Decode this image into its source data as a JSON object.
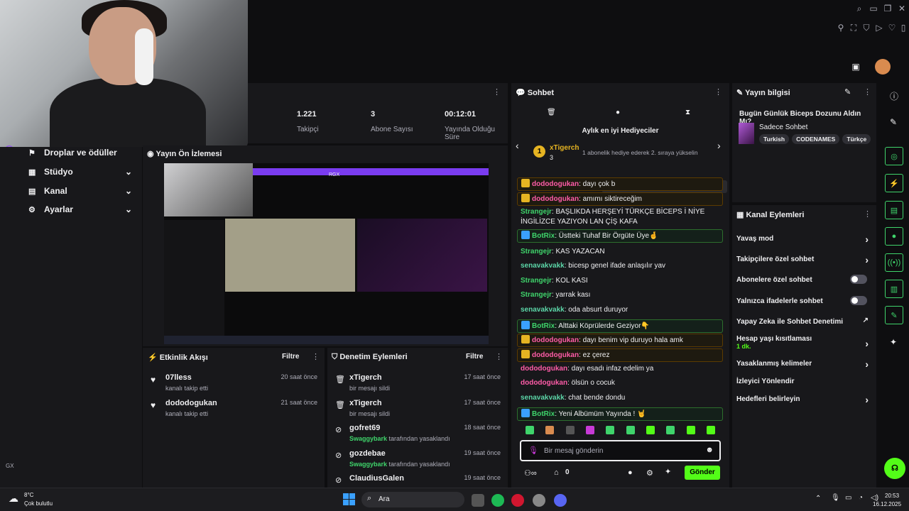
{
  "stats": {
    "followers_value": "1.221",
    "followers_label": "Takipçi",
    "subs_value": "3",
    "subs_label": "Abone Sayısı",
    "uptime_value": "00:12:01",
    "uptime_label": "Yayında Olduğu Süre"
  },
  "nav": {
    "items": [
      {
        "label": "Droplar ve ödüller"
      },
      {
        "label": "Stüdyo"
      },
      {
        "label": "Kanal"
      },
      {
        "label": "Ayarlar"
      }
    ],
    "footer": "GX"
  },
  "preview": {
    "title": "Yayın Ön İzlemesi",
    "overlay_label": "RGX"
  },
  "activity": {
    "title": "Etkinlik Akışı",
    "filter": "Filtre",
    "items": [
      {
        "name": "07lless",
        "sub": "kanalı takip etti",
        "time": "20 saat önce"
      },
      {
        "name": "dododogukan",
        "sub": "kanalı takip etti",
        "time": "21 saat önce"
      }
    ]
  },
  "moderation": {
    "title": "Denetim Eylemleri",
    "filter": "Filtre",
    "items": [
      {
        "name": "xTigerch",
        "sub": "bir mesajı sildi",
        "time": "17 saat önce"
      },
      {
        "name": "xTigerch",
        "sub": "bir mesajı sildi",
        "time": "17 saat önce"
      },
      {
        "name": "gofret69",
        "sub_user": "Swaggybark",
        "sub": "tarafından yasaklandı",
        "time": "18 saat önce"
      },
      {
        "name": "gozdebae",
        "sub_user": "Swaggybark",
        "sub": "tarafından yasaklandı",
        "time": "19 saat önce"
      },
      {
        "name": "ClaudiusGalen",
        "time": "19 saat önce"
      }
    ]
  },
  "chat": {
    "title": "Sohbet",
    "gifters_title": "Aylık en iyi Hediyeciler",
    "gifter_name": "xTigerch",
    "gifter_rank": "1",
    "gifter_count": "3",
    "gifter_promo": "1 abonelik hediye ederek 2. sıraya yükselin",
    "messages": [
      {
        "user": "dododogukan",
        "text": "dayı çok b",
        "style": "hl",
        "ucls": "u-pink"
      },
      {
        "user": "dododogukan",
        "text": "amımı siktireceğim",
        "style": "hl",
        "ucls": "u-pink"
      },
      {
        "user": "Strangejr",
        "text": "BAŞLIKDA HERŞEYİ TÜRKÇE BİCEPS İ NİYE İNGİLİZCE YAZIYON LAN ÇİŞ KAFA",
        "style": "",
        "ucls": "u-green"
      },
      {
        "user": "BotRix",
        "text": "Üstteki Tuhaf Bir Örgüte Üye🤞",
        "style": "hlg",
        "ucls": "u-green"
      },
      {
        "user": "Strangejr",
        "text": "KAS YAZACAN",
        "style": "",
        "ucls": "u-green"
      },
      {
        "user": "senavakvakk",
        "text": "bicesp genel ifade anlaşılır yav",
        "style": "",
        "ucls": "u-teal"
      },
      {
        "user": "Strangejr",
        "text": "KOL KASI",
        "style": "",
        "ucls": "u-green"
      },
      {
        "user": "Strangejr",
        "text": "yarrak kası",
        "style": "",
        "ucls": "u-green"
      },
      {
        "user": "senavakvakk",
        "text": "oda absurt duruyor",
        "style": "",
        "ucls": "u-teal"
      },
      {
        "user": "BotRix",
        "text": "Alttaki Köprülerde Geziyor👇",
        "style": "hlg",
        "ucls": "u-green"
      },
      {
        "user": "dododogukan",
        "text": "dayı benim vip duruyo hala amk",
        "style": "hl",
        "ucls": "u-pink"
      },
      {
        "user": "dododogukan",
        "text": "ez çerez",
        "style": "hl",
        "ucls": "u-pink"
      },
      {
        "user": "dododogukan",
        "text": "dayı esadı infaz edelim ya",
        "style": "",
        "ucls": "u-pink"
      },
      {
        "user": "dododogukan",
        "text": "ölsün o cocuk",
        "style": "",
        "ucls": "u-pink"
      },
      {
        "user": "senavakvakk",
        "text": "chat bende dondu",
        "style": "",
        "ucls": "u-teal"
      },
      {
        "user": "BotRix",
        "text": "Yeni Albümüm Yayında ! 🤘",
        "style": "hlg",
        "ucls": "u-green"
      }
    ],
    "input_placeholder": "Bir mesaj gönderin",
    "send_label": "Gönder",
    "points": "0"
  },
  "info": {
    "title": "Yayın bilgisi",
    "stream_title": "Bugün Günlük Biceps Dozunu Aldın Mı?",
    "category": "Sadece Sohbet",
    "tags": [
      "Turkish",
      "CODENAMES",
      "Türkçe"
    ]
  },
  "actions": {
    "title": "Kanal Eylemleri",
    "items": [
      {
        "label": "Yavaş mod",
        "kind": "chev"
      },
      {
        "label": "Takipçilere özel sohbet",
        "kind": "chev"
      },
      {
        "label": "Abonelere özel sohbet",
        "kind": "toggle"
      },
      {
        "label": "Yalnızca ifadelerle sohbet",
        "kind": "toggle"
      },
      {
        "label": "Yapay Zeka ile Sohbet Denetimi",
        "kind": "ext"
      },
      {
        "label": "Hesap yaşı kısıtlaması",
        "sub": "1 dk.",
        "kind": "chev"
      },
      {
        "label": "Yasaklanmış kelimeler",
        "kind": "chev"
      },
      {
        "label": "İzleyici Yönlendir",
        "kind": "none"
      },
      {
        "label": "Hedefleri belirleyin",
        "kind": "chev"
      }
    ]
  },
  "taskbar": {
    "temp": "8°C",
    "weather": "Çok bulutlu",
    "search": "Ara",
    "time": "20:53",
    "date": "16.12.2025"
  },
  "colors": {
    "accent": "#9147ff",
    "green": "#53fc18",
    "bg": "#0e0e10",
    "panel": "#18181b"
  }
}
